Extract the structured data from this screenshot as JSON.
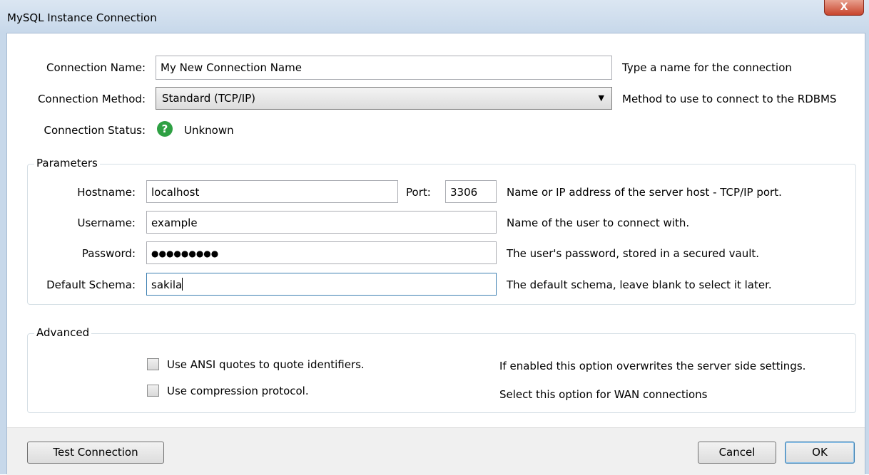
{
  "window": {
    "title": "MySQL Instance Connection",
    "close": "X"
  },
  "connection": {
    "name_label": "Connection Name:",
    "name_value": "My New Connection Name",
    "name_help": "Type a name for the connection",
    "method_label": "Connection Method:",
    "method_value": "Standard (TCP/IP)",
    "method_help": "Method to use to connect to the RDBMS",
    "status_label": "Connection Status:",
    "status_icon": "?",
    "status_value": "Unknown",
    "status_color": "#2ea043"
  },
  "parameters": {
    "title": "Parameters",
    "hostname_label": "Hostname:",
    "hostname_value": "localhost",
    "port_label": "Port:",
    "port_value": "3306",
    "hostname_help": "Name or IP address of the server host - TCP/IP port.",
    "username_label": "Username:",
    "username_value": "example",
    "username_help": "Name of the user to connect with.",
    "password_label": "Password:",
    "password_value": "●●●●●●●●●",
    "password_help": "The user's password, stored in a secured vault.",
    "schema_label": "Default Schema:",
    "schema_value": "sakila",
    "schema_help": "The default schema, leave blank to select it later."
  },
  "advanced": {
    "title": "Advanced",
    "ansi_label": "Use ANSI quotes to quote identifiers.",
    "ansi_help": "If enabled this option overwrites the server side settings.",
    "compression_label": "Use compression protocol.",
    "compression_help": "Select this option for WAN connections"
  },
  "footer": {
    "test_label": "Test Connection",
    "cancel_label": "Cancel",
    "ok_label": "OK"
  }
}
